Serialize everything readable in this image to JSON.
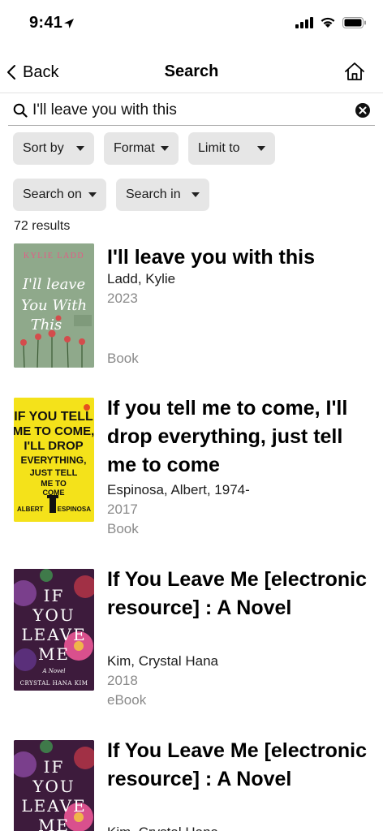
{
  "status_bar": {
    "time": "9:41"
  },
  "nav": {
    "back_label": "Back",
    "title": "Search"
  },
  "search": {
    "query": "I'll leave you with this"
  },
  "filters": {
    "sort_by": "Sort by",
    "format": "Format",
    "limit_to": "Limit to",
    "search_on": "Search on",
    "search_in": "Search in"
  },
  "results_count": "72 results",
  "results": [
    {
      "title": "I'll leave you with this",
      "author": "Ladd, Kylie",
      "year": "2023",
      "format": "Book",
      "cover": {
        "top_text": "KYLIE LADD",
        "main_text": "I'll leave You With This"
      }
    },
    {
      "title": "If you tell me to come, I'll drop everything, just tell me to come",
      "author": "Espinosa, Albert, 1974-",
      "year": "2017",
      "format": "Book",
      "cover": {
        "main_text": "IF YOU TELL ME TO COME, I'LL DROP EVERYTHING, JUST TELL ME TO COME",
        "footer_left": "ALBERT",
        "footer_right": "ESPINOSA"
      }
    },
    {
      "title": "If You Leave Me [electronic resource] : A Novel",
      "author": "Kim, Crystal Hana",
      "year": "2018",
      "format": "eBook",
      "cover": {
        "main_text": "IF YOU LEAVE ME",
        "subtitle": "A Novel",
        "footer": "CRYSTAL HANA KIM"
      }
    },
    {
      "title": "If You Leave Me [electronic resource] : A Novel",
      "author": "Kim, Crystal Hana",
      "year": "",
      "format": "",
      "cover": {
        "main_text": "IF YOU LEAVE ME"
      }
    }
  ],
  "colors": {
    "chip_bg": "#e6e6e6",
    "muted_text": "#8a8a8a",
    "cover2_bg": "#f4e21a",
    "cover1_bg": "#8fa98b",
    "cover3_bg": "#3d1b3c"
  },
  "icons": [
    "location-arrow-icon",
    "signal-icon",
    "wifi-icon",
    "battery-icon",
    "chevron-left-icon",
    "home-icon",
    "search-icon",
    "clear-icon",
    "caret-down-icon"
  ]
}
